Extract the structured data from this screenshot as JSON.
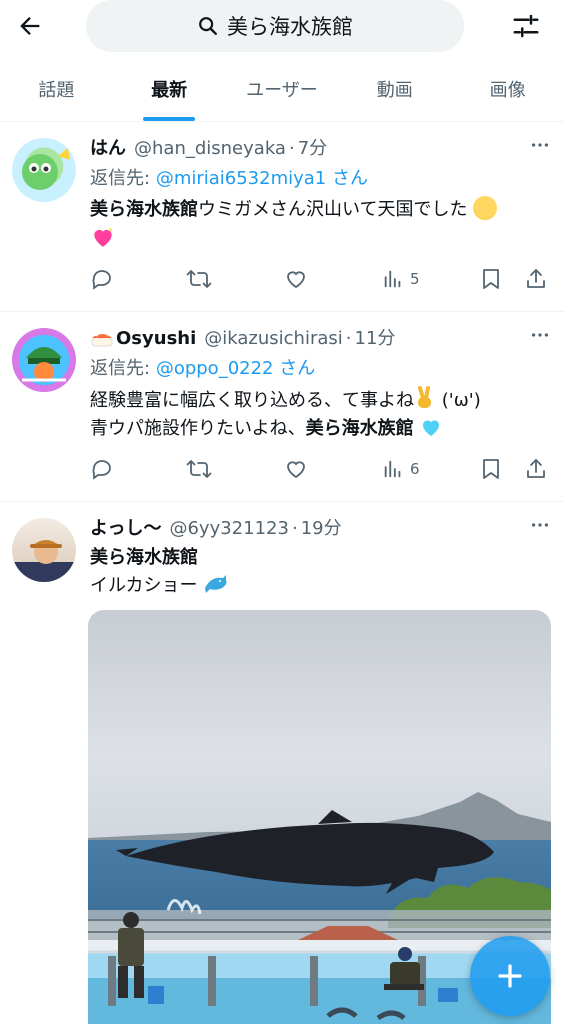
{
  "header": {
    "search_query": "美ら海水族館"
  },
  "tabs": [
    {
      "label": "話題"
    },
    {
      "label": "最新"
    },
    {
      "label": "ユーザー"
    },
    {
      "label": "動画"
    },
    {
      "label": "画像"
    }
  ],
  "active_tab": "最新",
  "tweets": [
    {
      "name": "はん",
      "handle": "@han_disneyaka",
      "time": "7分",
      "reply_prefix": "返信先:",
      "reply_to": "@miriai6532miya1 さん",
      "text_bold": "美ら海水族館",
      "text_rest": "ウミガメさん沢山いて天国でした",
      "views": "5"
    },
    {
      "name": "Osyushi",
      "handle": "@ikazusichirasi",
      "time": "11分",
      "reply_prefix": "返信先:",
      "reply_to": "@oppo_0222 さん",
      "text_line1": "経験豊富に幅広く取り込める、て事よね",
      "text_line1_tail": " ('ω')",
      "text_line2_pre": "青ウパ施設作りたいよね、",
      "text_bold": "美ら海水族館",
      "views": "6"
    },
    {
      "name": "よっし〜",
      "handle": "@6yy321123",
      "time": "19分",
      "text_bold": "美ら海水族館",
      "text_line2": "イルカショー"
    }
  ],
  "colors": {
    "accent": "#1d9bf0",
    "text": "#0f1419",
    "muted": "#536471",
    "divider": "#eff3f4"
  },
  "icons": [
    "back-arrow-icon",
    "search-icon",
    "filter-sliders-icon",
    "more-icon",
    "reply-icon",
    "retweet-icon",
    "like-icon",
    "views-icon",
    "bookmark-icon",
    "share-icon",
    "compose-plus-icon"
  ]
}
